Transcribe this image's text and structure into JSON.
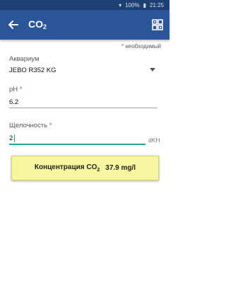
{
  "status_bar": {
    "battery_percent": "100%",
    "time": "21:25"
  },
  "header": {
    "title_main": "CO",
    "title_sub": "2",
    "colors": {
      "app_bar": "#2b5599",
      "status_bar": "#1c3f74"
    }
  },
  "form": {
    "required_note": "необходимый",
    "required_marker": "*",
    "aquarium": {
      "label": "Аквариум",
      "value": "JEBO R352 KG"
    },
    "ph": {
      "label": "pH",
      "value": "6.2"
    },
    "alkalinity": {
      "label": "Щелочность",
      "value": "2",
      "unit": "dKH"
    }
  },
  "result": {
    "label_main": "Концентрация CO",
    "label_sub": "2",
    "value": "37.9 mg/l",
    "colors": {
      "background": "#f7f69f"
    }
  },
  "icons": [
    "back-arrow-icon",
    "grid-icon",
    "dropdown-arrow-icon"
  ]
}
